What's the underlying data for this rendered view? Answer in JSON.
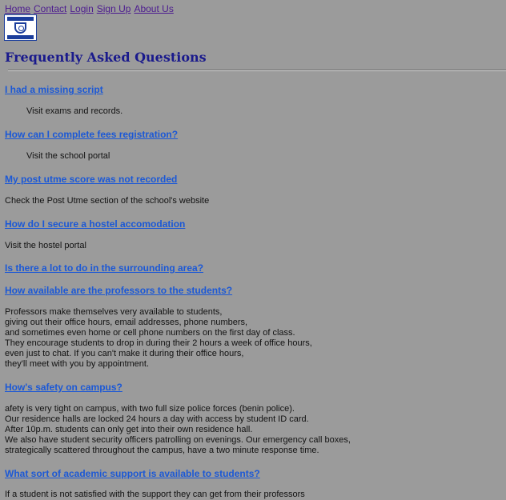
{
  "nav": {
    "home": "Home",
    "contact": "Contact",
    "login": "Login",
    "signup": "Sign Up",
    "about": "About Us"
  },
  "page": {
    "title": "Frequently Asked Questions"
  },
  "faqs": [
    {
      "question": "I had a missing script",
      "answer": [
        "Visit exams and records."
      ]
    },
    {
      "question": "How can I complete fees registration?",
      "answer": [
        "Visit the school portal"
      ]
    },
    {
      "question": "My post utme score was not recorded",
      "answer": [
        "Check the Post Utme section of the school's website"
      ]
    },
    {
      "question": "How do I secure a hostel accomodation",
      "answer": [
        "Visit the hostel portal"
      ]
    },
    {
      "question": "Is there a lot to do in the surrounding area?",
      "answer": []
    },
    {
      "question": "How available are the professors to the students?",
      "answer": [
        "Professors make themselves very available to students,",
        "giving out their office hours, email addresses, phone numbers,",
        "and sometimes even home or cell phone numbers on the first day of class.",
        "They encourage students to drop in during their 2 hours a week of office hours,",
        "even just to chat. If you can't make it during their office hours,",
        "they'll meet with you by appointment."
      ]
    },
    {
      "question": "How's safety on campus?",
      "answer": [
        "afety is very tight on campus, with two full size police forces (benin police).",
        "Our residence halls are locked 24 hours a day with access by student ID card.",
        "After 10p.m. students can only get into their own residence hall.",
        "We also have student security officers patrolling on evenings. Our emergency call boxes,",
        "strategically scattered throughout the campus, have a two minute response time."
      ]
    },
    {
      "question": "What sort of academic support is available to students?",
      "answer": [
        "If a student is not satisfied with the support they can get from their professors"
      ]
    }
  ]
}
